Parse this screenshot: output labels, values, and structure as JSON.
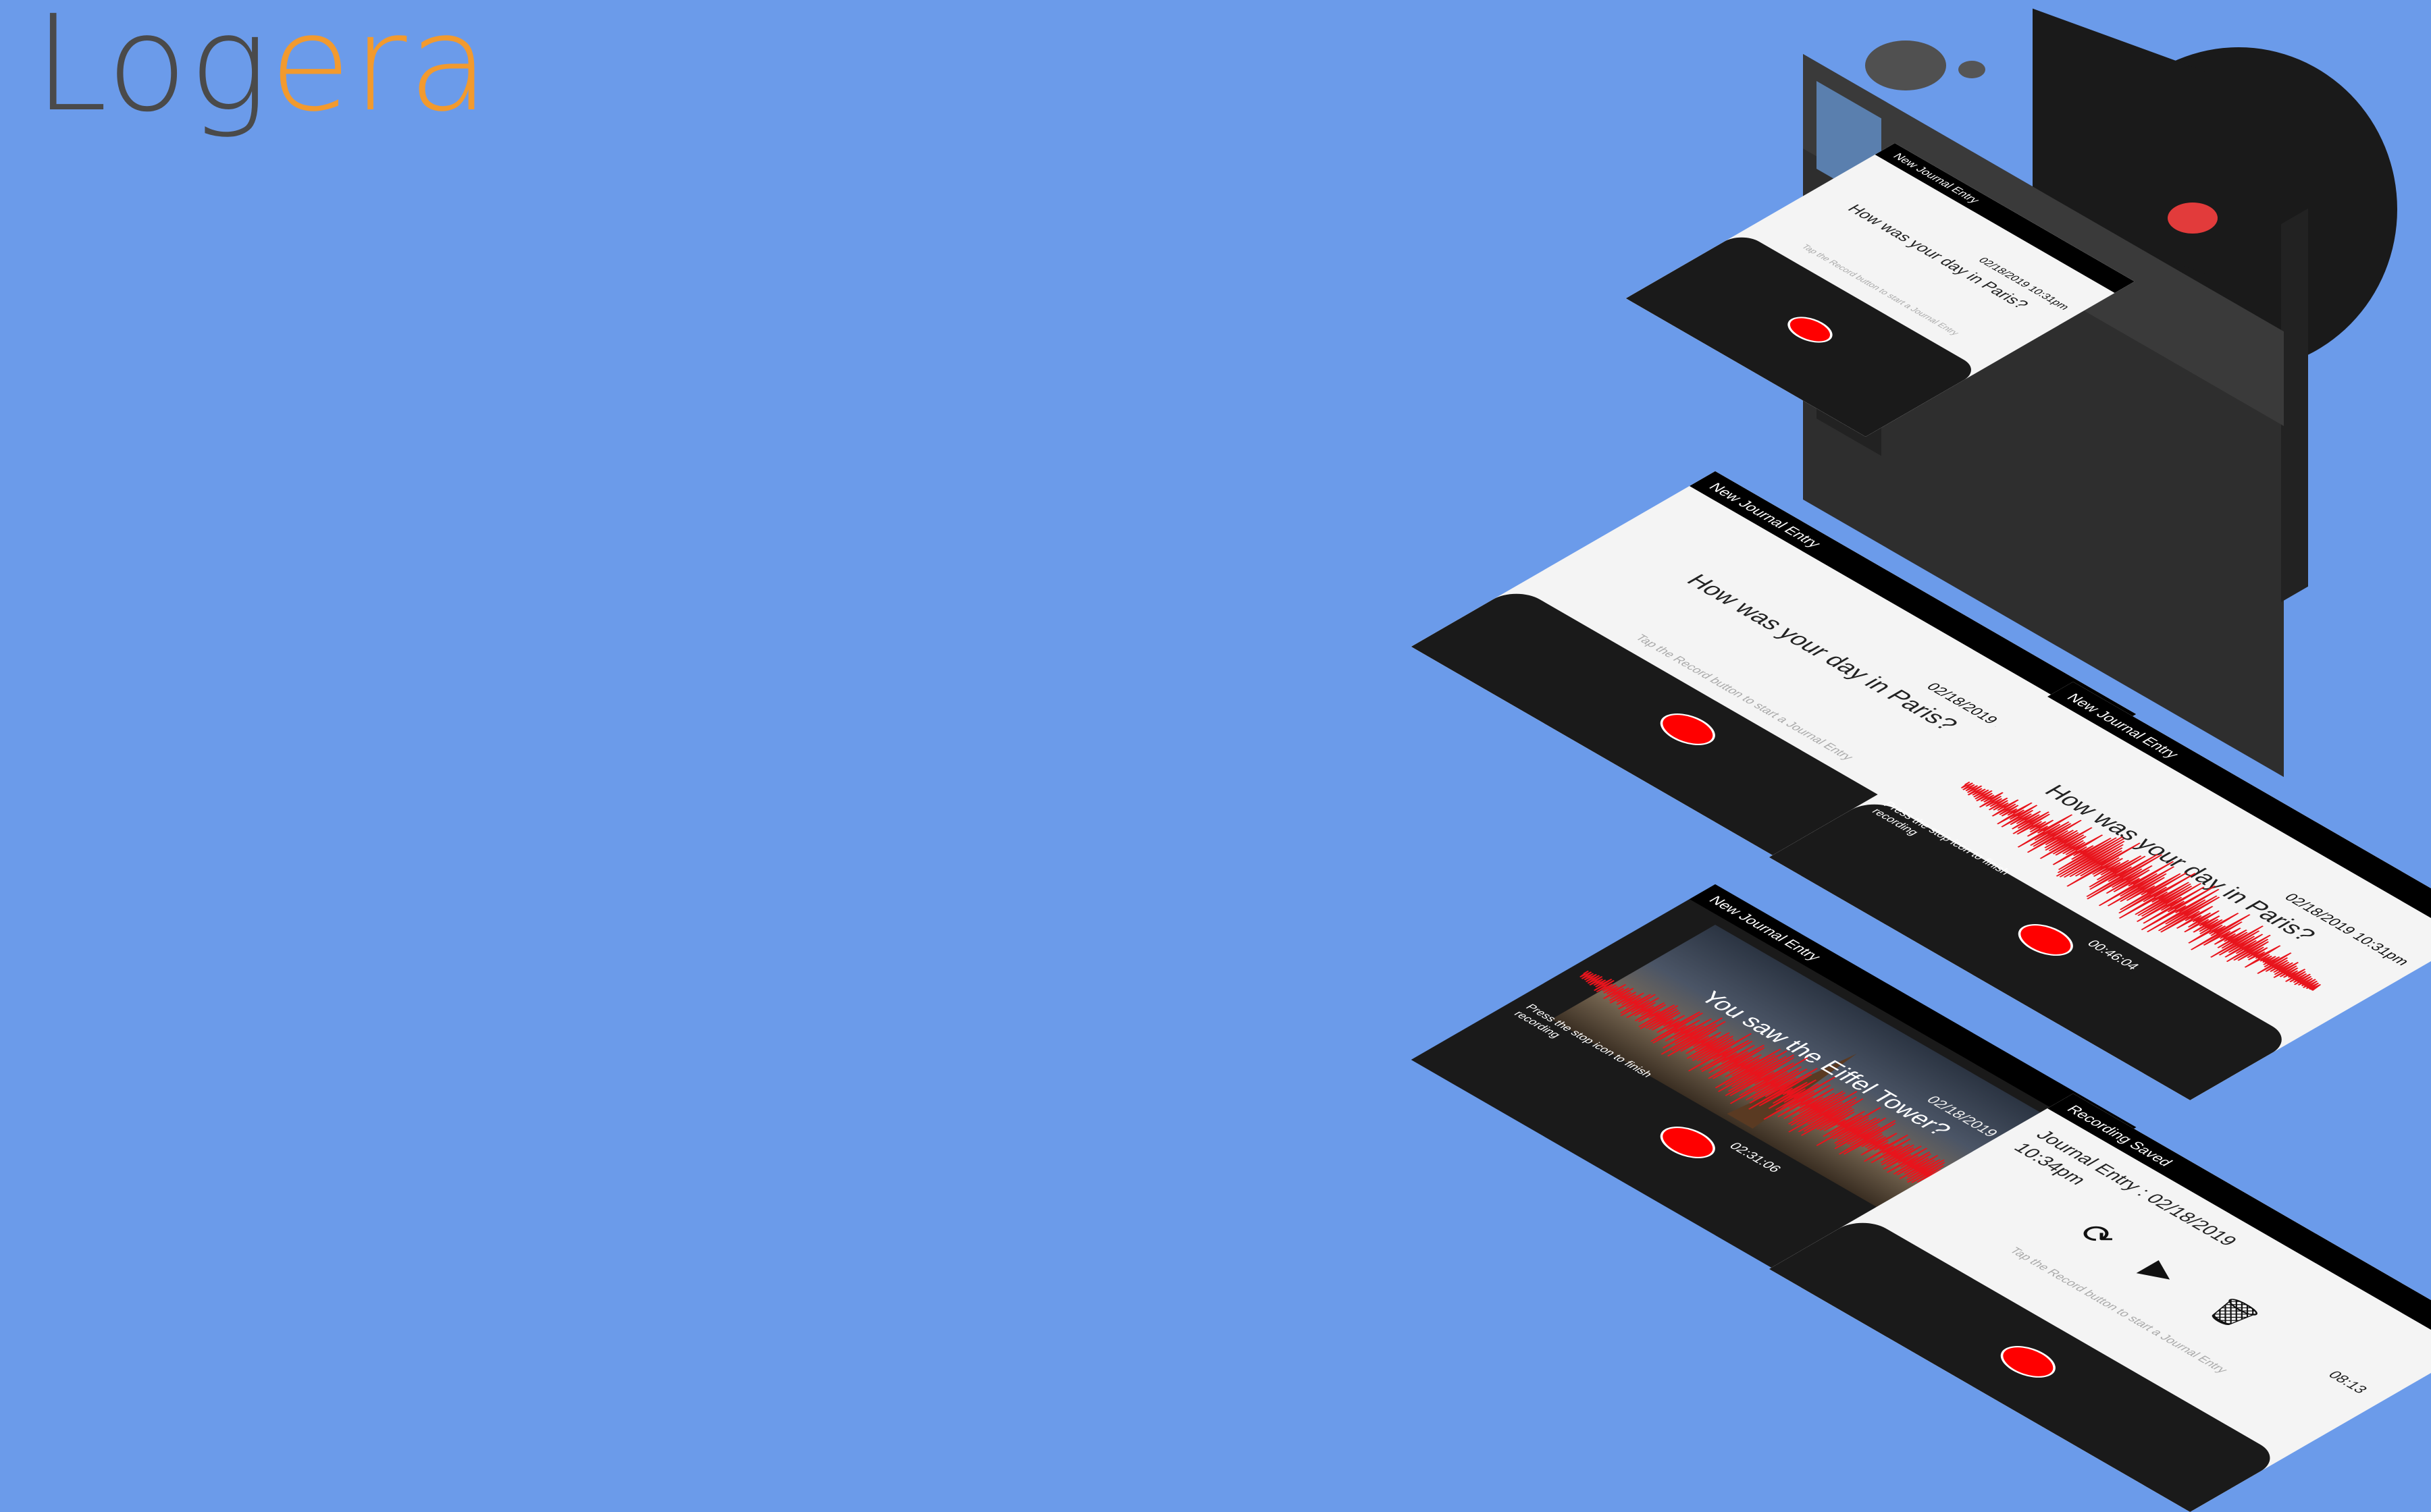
{
  "brand": {
    "part1": "Log",
    "part2": "era"
  },
  "screen_common": {
    "header_new": "New Journal Entry",
    "header_saved": "Recording Saved",
    "datetime": "02/18/2019 10:31pm",
    "question": "How was your day in Paris?",
    "hint": "Tap the Record button to start a Journal Entry",
    "stop_instruction": "Press the stop icon to finish recording"
  },
  "camera_screen": {
    "header": "New Journal Entry",
    "datetime": "02/18/2019 10:31pm",
    "question": "How was your day in Paris?",
    "hint": "Tap the Record button to start a Journal Entry"
  },
  "screen1": {
    "header": "New Journal Entry",
    "datetime": "02/18/2019 10:31pm",
    "question": "How was your day in Paris?",
    "hint": "Tap the Record button to start a Journal Entry"
  },
  "screen2": {
    "header": "New Journal Entry",
    "datetime": "02/18/2019 10:31pm",
    "question": "How was your day in Paris?",
    "instruction": "Press the stop icon to finish recording",
    "timer": "00:46:04"
  },
  "screen3": {
    "header": "New Journal Entry",
    "datetime": "02/18/2019 10:31pm",
    "question": "You saw the Eiffel Tower?",
    "instruction": "Press the stop icon to finish recording",
    "timer": "02:31:06"
  },
  "screen4": {
    "header": "Recording Saved",
    "entry_title": "Journal Entry : 02/18/2019",
    "entry_time": "10:34pm",
    "length": "08:13",
    "hint": "Tap the Record button to start a Journal Entry"
  },
  "icons": [
    "camera-icon",
    "journal-book-icon",
    "back-arrow-icon",
    "record-icon",
    "replay-icon",
    "play-icon",
    "trash-icon"
  ],
  "colors": {
    "background": "#6b9bea",
    "brand_dark": "#4a4a4a",
    "brand_accent": "#f29a2e",
    "record": "#ff0000",
    "waveform": "#e8141c"
  }
}
